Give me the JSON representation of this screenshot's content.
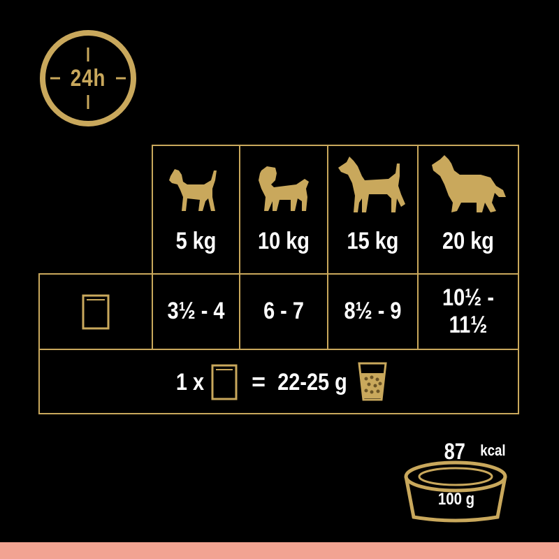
{
  "timing": {
    "label": "24h",
    "icon": "clock-24h-icon"
  },
  "weights": [
    "5 kg",
    "10 kg",
    "15 kg",
    "20 kg"
  ],
  "pouch_row": {
    "icon": "pouch-icon",
    "amounts": [
      "3½ - 4",
      "6 - 7",
      "8½ - 9",
      "10½ -\n11½"
    ]
  },
  "equivalence": {
    "prefix": "1 x",
    "equals": "=",
    "grams": "22-25 g",
    "cup_icon": "measuring-cup-icon"
  },
  "energy": {
    "kcal_value": "87",
    "kcal_unit": "kcal",
    "per_amount": "100 g",
    "bowl_icon": "bowl-icon"
  },
  "colors": {
    "gold": "#c9a85c",
    "background": "#000000",
    "accent_strip": "#f2a392"
  }
}
